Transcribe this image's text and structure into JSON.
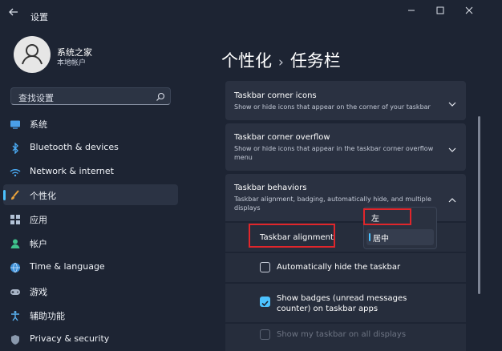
{
  "window": {
    "title": "设置",
    "controls": [
      "minimize",
      "maximize",
      "close"
    ]
  },
  "user": {
    "name": "系统之家",
    "account": "本地帐户"
  },
  "search": {
    "placeholder": "查找设置"
  },
  "nav": [
    {
      "label": "系统",
      "icon": "system-icon",
      "active": false
    },
    {
      "label": "Bluetooth & devices",
      "icon": "bluetooth-icon",
      "active": false
    },
    {
      "label": "Network & internet",
      "icon": "wifi-icon",
      "active": false
    },
    {
      "label": "个性化",
      "icon": "brush-icon",
      "active": true
    },
    {
      "label": "应用",
      "icon": "apps-icon",
      "active": false
    },
    {
      "label": "帐户",
      "icon": "account-icon",
      "active": false
    },
    {
      "label": "Time & language",
      "icon": "globe-icon",
      "active": false
    },
    {
      "label": "游戏",
      "icon": "gamepad-icon",
      "active": false
    },
    {
      "label": "辅助功能",
      "icon": "accessibility-icon",
      "active": false
    },
    {
      "label": "Privacy & security",
      "icon": "shield-icon",
      "active": false
    }
  ],
  "breadcrumb": {
    "parent": "个性化",
    "separator": "›",
    "current": "任务栏"
  },
  "sections": [
    {
      "title": "Taskbar corner icons",
      "desc": "Show or hide icons that appear on the corner of your taskbar",
      "expanded": false
    },
    {
      "title": "Taskbar corner overflow",
      "desc": "Show or hide icons that appear in the taskbar corner overflow menu",
      "expanded": false
    },
    {
      "title": "Taskbar behaviors",
      "desc": "Taskbar alignment, badging, automatically hide, and multiple displays",
      "expanded": true
    }
  ],
  "behaviors": {
    "alignment_label": "Taskbar alignment",
    "alignment_options": [
      "左",
      "居中"
    ],
    "alignment_selected": "居中",
    "auto_hide": {
      "label": "Automatically hide the taskbar",
      "checked": false
    },
    "badges": {
      "label": "Show badges (unread messages counter) on taskbar apps",
      "checked": true
    },
    "all_displays": {
      "label": "Show my taskbar on all displays",
      "checked": false,
      "disabled": true
    }
  },
  "colors": {
    "background": "#1d2433",
    "card": "#2a3141",
    "accent": "#4cc2ff",
    "highlight_box": "#e0262b"
  }
}
